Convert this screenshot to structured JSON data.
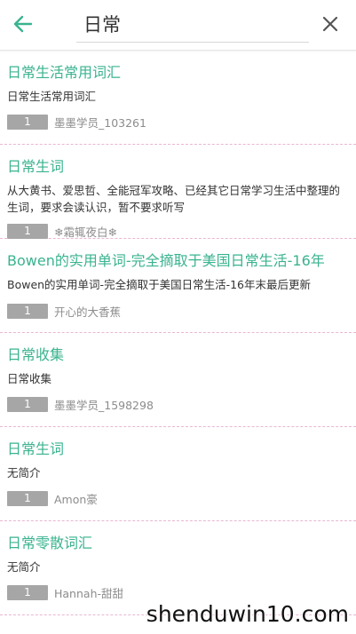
{
  "search": {
    "query": "日常"
  },
  "results": [
    {
      "title": "日常生活常用词汇",
      "desc": "日常生活常用词汇",
      "count": "1",
      "author": "墨墨学员_103261"
    },
    {
      "title": "日常生词",
      "desc": "从大黄书、爱思哲、全能冠军攻略、已经其它日常学习生活中整理的生词，要求会读认识，暂不要求听写",
      "count": "1",
      "author": "❄霜辄夜白❄"
    },
    {
      "title": "Bowen的实用单词-完全摘取于美国日常生活-16年",
      "desc": "Bowen的实用单词-完全摘取于美国日常生活-16年末最后更新",
      "count": "1",
      "author": "开心的大香蕉"
    },
    {
      "title": "日常收集",
      "desc": "日常收集",
      "count": "1",
      "author": "墨墨学员_1598298"
    },
    {
      "title": "日常生词",
      "desc": "无简介",
      "count": "1",
      "author": "Amon豪"
    },
    {
      "title": "日常零散词汇",
      "desc": "无简介",
      "count": "1",
      "author": "Hannah-甜甜"
    }
  ],
  "watermark": "shenduwin10.com",
  "colors": {
    "accent": "#3ab38f",
    "badge": "#a6a6a6",
    "divider": "#e8b7d0"
  },
  "icons": {
    "back": "arrow-left-icon",
    "clear": "close-icon"
  }
}
